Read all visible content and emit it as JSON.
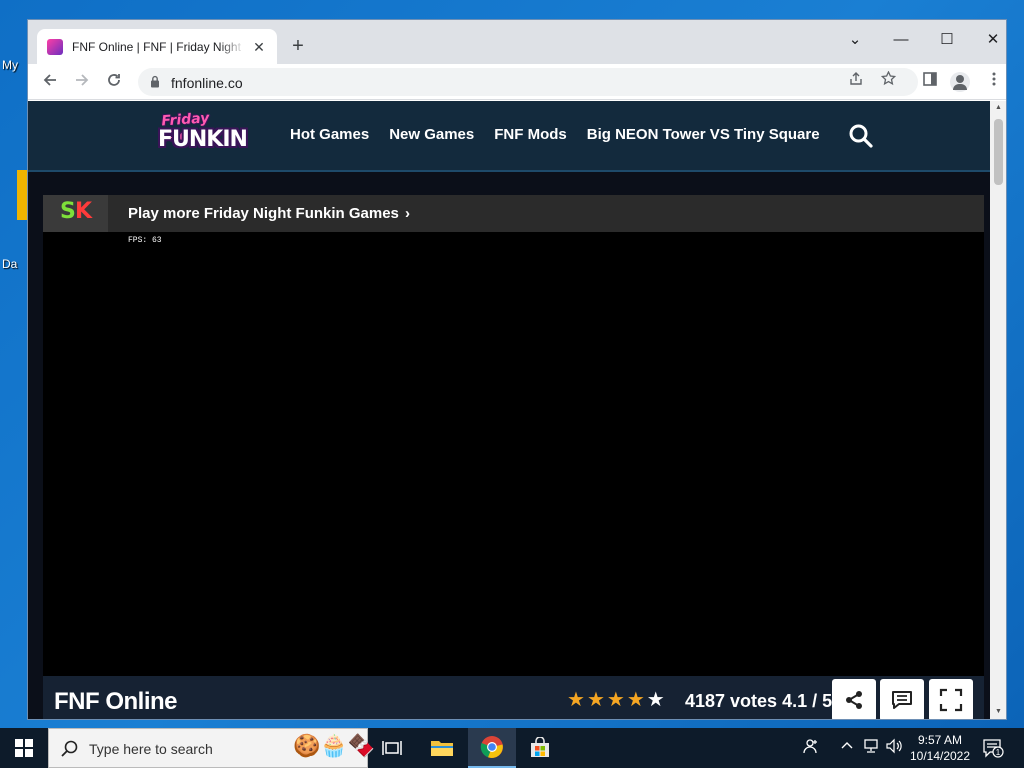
{
  "desktop": {
    "icon_labels": [
      "My",
      "Da"
    ]
  },
  "browser": {
    "tab": {
      "title": "FNF Online | FNF | Friday Night Funkin",
      "close": "✕"
    },
    "new_tab": "+",
    "window_controls": {
      "tabsearch": "⌄",
      "minimize": "—",
      "maximize": "☐",
      "close": "✕"
    },
    "url": "fnfonline.co"
  },
  "site": {
    "logo": {
      "top": "Friday Night",
      "bottom": "FUNKIN"
    },
    "nav": [
      "Hot Games",
      "New Games",
      "FNF Mods",
      "Big NEON Tower VS Tiny Square"
    ],
    "promo": {
      "logo_left": "S",
      "logo_right": "K",
      "text": "Play more Friday Night Funkin Games",
      "chevron": "›"
    },
    "game": {
      "fps": "FPS: 63"
    },
    "footer": {
      "title": "FNF Online",
      "rating_filled": 4,
      "rating_total": 5,
      "votes": "4187 votes 4.1 / 5"
    }
  },
  "taskbar": {
    "search_placeholder": "Type here to search",
    "time": "9:57 AM",
    "date": "10/14/2022",
    "notification_count": "1"
  },
  "colors": {
    "header_bg": "#132a3d",
    "star": "#f5a623",
    "page_bg": "#0b0f19"
  }
}
